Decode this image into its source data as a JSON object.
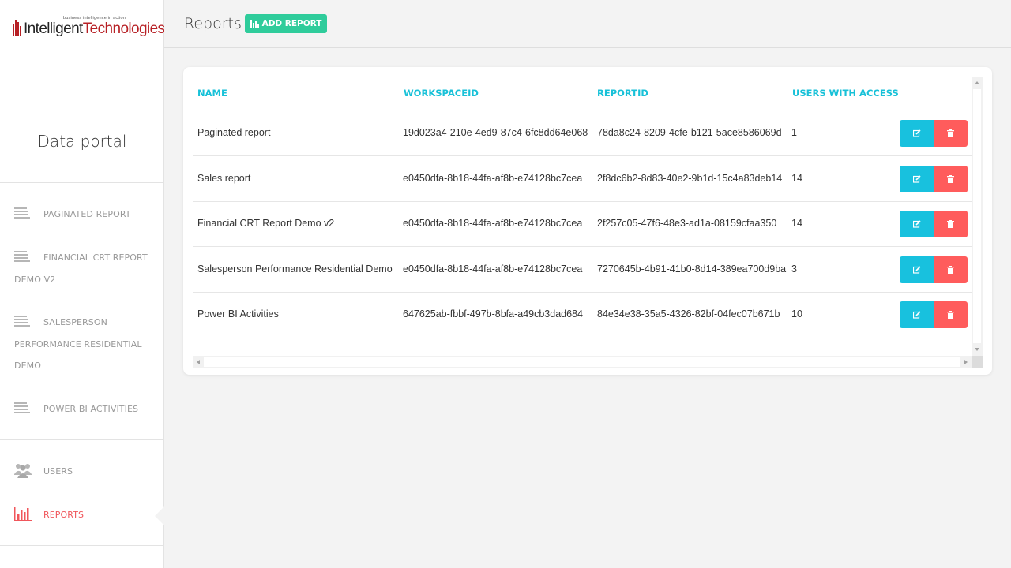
{
  "logo": {
    "tagline": "business intelligence in action",
    "word1": "Intelligent",
    "word2": "Technologies",
    "brand_color": "#b72025"
  },
  "sidebar": {
    "title": "Data portal",
    "reports": [
      {
        "label": "PAGINATED REPORT",
        "icon": "list-icon"
      },
      {
        "label": "FINANCIAL CRT REPORT DEMO V2",
        "icon": "list-icon"
      },
      {
        "label": "SALESPERSON PERFORMANCE RESIDENTIAL DEMO",
        "icon": "list-icon"
      },
      {
        "label": "POWER BI ACTIVITIES",
        "icon": "list-icon"
      }
    ],
    "admin": [
      {
        "label": "USERS",
        "icon": "users-icon"
      },
      {
        "label": "REPORTS",
        "icon": "bar-chart-icon",
        "active": true
      }
    ],
    "active_color": "#f0565b"
  },
  "header": {
    "title": "Reports",
    "add_button_label": "ADD REPORT",
    "add_button_color": "#2fcc9b"
  },
  "table": {
    "columns": [
      "NAME",
      "WORKSPACEID",
      "REPORTID",
      "USERS WITH ACCESS"
    ],
    "header_color": "#18c1d8",
    "rows": [
      {
        "name": "Paginated report",
        "workspace_id": "19d023a4-210e-4ed9-87c4-6fc8dd64e068",
        "report_id": "78da8c24-8209-4cfe-b121-5ace8586069d",
        "users": "1"
      },
      {
        "name": "Sales report",
        "workspace_id": "e0450dfa-8b18-44fa-af8b-e74128bc7cea",
        "report_id": "2f8dc6b2-8d83-40e2-9b1d-15c4a83deb14",
        "users": "14"
      },
      {
        "name": "Financial CRT Report Demo v2",
        "workspace_id": "e0450dfa-8b18-44fa-af8b-e74128bc7cea",
        "report_id": "2f257c05-47f6-48e3-ad1a-08159cfaa350",
        "users": "14"
      },
      {
        "name": "Salesperson Performance Residential Demo",
        "workspace_id": "e0450dfa-8b18-44fa-af8b-e74128bc7cea",
        "report_id": "7270645b-4b91-41b0-8d14-389ea700d9ba",
        "users": "3"
      },
      {
        "name": "Power BI Activities",
        "workspace_id": "647625ab-fbbf-497b-8bfa-a49cb3dad684",
        "report_id": "84e34e38-35a5-4326-82bf-04fec07b671b",
        "users": "10"
      }
    ],
    "actions": {
      "edit_icon": "edit-icon",
      "delete_icon": "trash-icon",
      "edit_color": "#18c1de",
      "delete_color": "#ff5c5c"
    }
  }
}
